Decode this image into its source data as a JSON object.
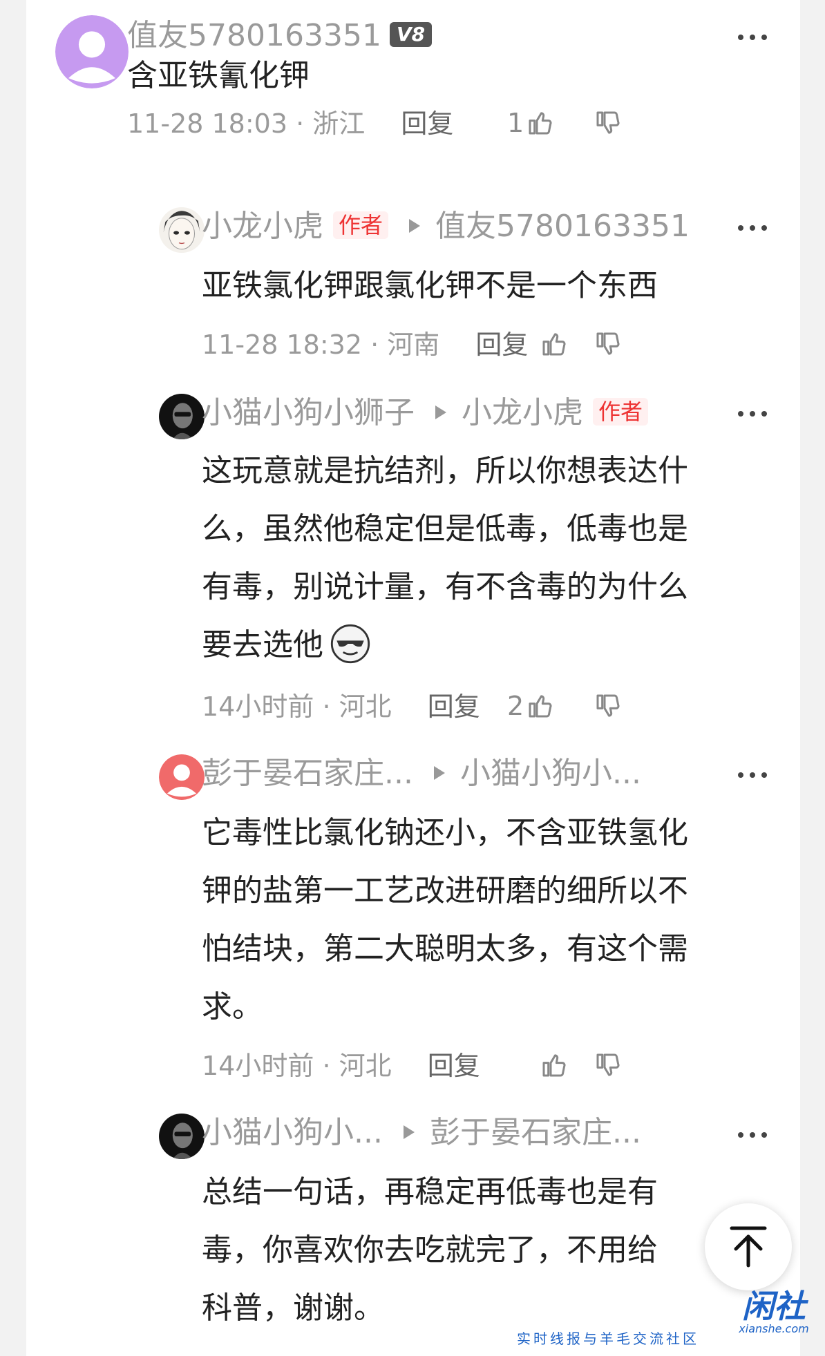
{
  "comments": [
    {
      "user": "值友5780163351",
      "level_badge": "V8",
      "avatar_icon": "default-user-avatar",
      "avatar_color": "#c69af0",
      "text": "含亚铁氰化钾",
      "time": "11-28 18:03",
      "sep": "·",
      "location": "浙江",
      "reply_label": "回复",
      "likes": "1"
    },
    {
      "user": "小龙小虎",
      "author_tag": "作者",
      "reply_to": "值友5780163351",
      "avatar_icon": "anime-portrait-avatar",
      "text": "亚铁氯化钾跟氯化钾不是一个东西",
      "time": "11-28 18:32",
      "sep": "·",
      "location": "河南",
      "reply_label": "回复",
      "likes": ""
    },
    {
      "user": "小猫小狗小狮子",
      "reply_to": "小龙小虎",
      "reply_to_tag": "作者",
      "avatar_icon": "dark-portrait-avatar",
      "text_lines": [
        "这玩意就是抗结剂，所以你想表达什",
        "么，虽然他稳定但是低毒，低毒也是",
        "有毒，别说计量，有不含毒的为什么",
        "要去选他"
      ],
      "emoji": "cool-sunglasses-emoji",
      "time": "14小时前",
      "sep": "·",
      "location": "河北",
      "reply_label": "回复",
      "likes": "2"
    },
    {
      "user": "彭于晏石家庄...",
      "reply_to": "小猫小狗小...",
      "avatar_icon": "default-user-avatar",
      "avatar_color": "#f06a6a",
      "text_lines": [
        "它毒性比氯化钠还小，不含亚铁氢化",
        "钾的盐第一工艺改进研磨的细所以不",
        "怕结块，第二大聪明太多，有这个需",
        "求。"
      ],
      "time": "14小时前",
      "sep": "·",
      "location": "河北",
      "reply_label": "回复",
      "likes": ""
    },
    {
      "user": "小猫小狗小...",
      "reply_to": "彭于晏石家庄...",
      "avatar_icon": "dark-portrait-avatar",
      "text_lines": [
        "总结一句话，再稳定再低毒也是有",
        "毒，你喜欢你去吃就完了，不用给",
        "科普，谢谢。"
      ]
    }
  ],
  "watermark": {
    "logo": "闲社",
    "domain": "xianshe.com",
    "slogan": "实时线报与羊毛交流社区"
  },
  "colors": {
    "name_gray": "#9a9a9a",
    "author_red": "#e33333",
    "brand_blue": "#1e63c6"
  }
}
